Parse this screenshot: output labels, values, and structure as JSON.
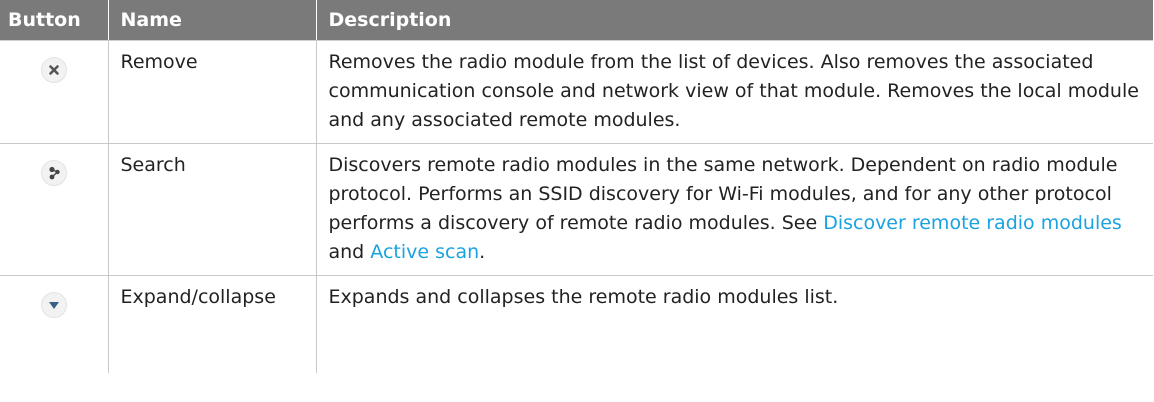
{
  "table": {
    "headers": {
      "button": "Button",
      "name": "Name",
      "description": "Description"
    },
    "rows": [
      {
        "icon": "close-icon",
        "name": "Remove",
        "description": "Removes the radio module from the list of devices. Also removes the associated communication console and network view of that module. Removes the local module and any associated remote modules."
      },
      {
        "icon": "search-network-icon",
        "name": "Search",
        "description_before": "Discovers remote radio modules in the same network. Dependent on radio module protocol. Performs an SSID discovery for Wi-Fi modules, and for any other protocol performs a discovery of remote radio modules. See ",
        "link1": "Discover remote radio modules",
        "description_mid": " and ",
        "link2": "Active scan",
        "description_after": "."
      },
      {
        "icon": "chevron-down-icon",
        "name": "Expand/collapse",
        "description": "Expands and collapses the remote radio modules list."
      }
    ]
  },
  "colors": {
    "header_bg": "#7a7a7a",
    "link": "#1aa3e0",
    "border": "#c8c8c8"
  }
}
